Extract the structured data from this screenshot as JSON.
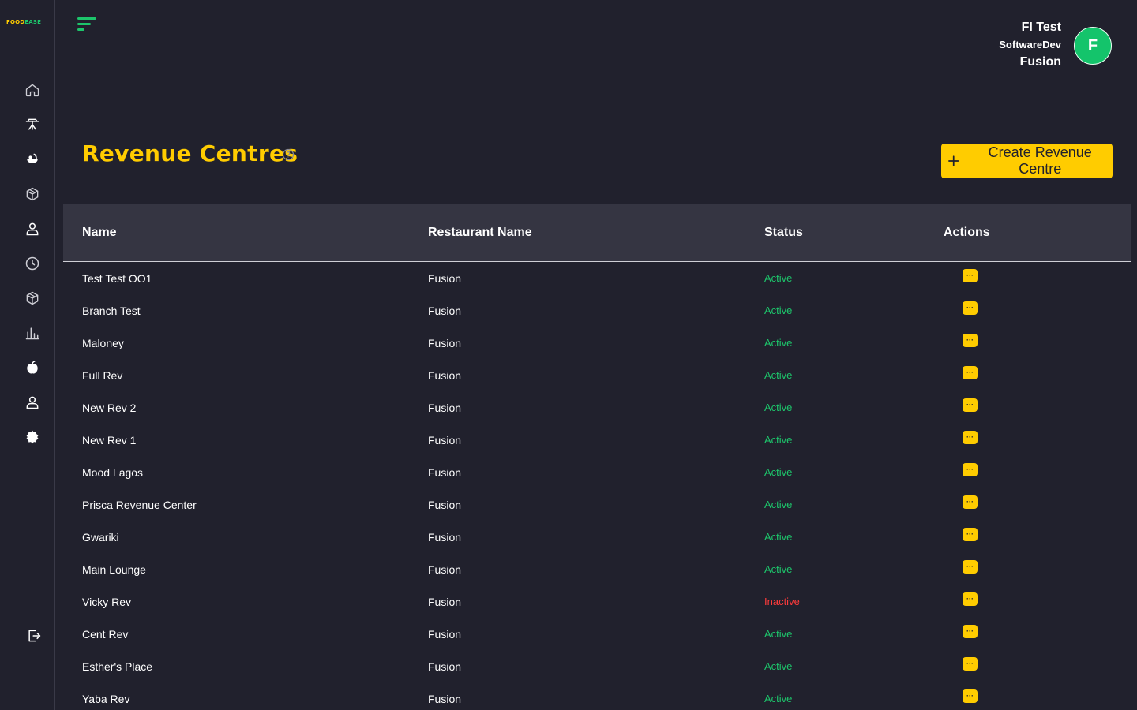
{
  "app": {
    "logo": {
      "part1": "FOOD",
      "part2": "EASE"
    },
    "colors": {
      "background": "#21212d",
      "accent": "#ffcc00",
      "success": "#1dc56b",
      "danger": "#ff3b3b",
      "table_header": "#353542"
    }
  },
  "sidebar": {
    "items": [
      {
        "icon": "home-icon"
      },
      {
        "icon": "table-icon"
      },
      {
        "icon": "food-icon"
      },
      {
        "icon": "box-icon"
      },
      {
        "icon": "user-icon"
      },
      {
        "icon": "clock-icon"
      },
      {
        "icon": "inventory-icon"
      },
      {
        "icon": "chart-icon"
      },
      {
        "icon": "fruit-icon"
      },
      {
        "icon": "staff-icon"
      },
      {
        "icon": "settings-icon"
      }
    ],
    "logout_icon": "logout-icon"
  },
  "header": {
    "user": {
      "name": "FI Test",
      "role": "SoftwareDev",
      "organization": "Fusion",
      "avatar_initial": "F"
    }
  },
  "page": {
    "title": "Revenue Centres",
    "create_button_label": "Create Revenue Centre"
  },
  "table": {
    "columns": {
      "name": "Name",
      "restaurant": "Restaurant Name",
      "status": "Status",
      "actions": "Actions"
    },
    "action_label": "···",
    "rows": [
      {
        "name": "Test Test OO1",
        "restaurant": "Fusion",
        "status": "Active"
      },
      {
        "name": "Branch Test",
        "restaurant": "Fusion",
        "status": "Active"
      },
      {
        "name": "Maloney",
        "restaurant": "Fusion",
        "status": "Active"
      },
      {
        "name": "Full Rev",
        "restaurant": "Fusion",
        "status": "Active"
      },
      {
        "name": "New Rev 2",
        "restaurant": "Fusion",
        "status": "Active"
      },
      {
        "name": "New Rev 1",
        "restaurant": "Fusion",
        "status": "Active"
      },
      {
        "name": "Mood Lagos",
        "restaurant": "Fusion",
        "status": "Active"
      },
      {
        "name": "Prisca Revenue Center",
        "restaurant": "Fusion",
        "status": "Active"
      },
      {
        "name": "Gwariki",
        "restaurant": "Fusion",
        "status": "Active"
      },
      {
        "name": "Main Lounge",
        "restaurant": "Fusion",
        "status": "Active"
      },
      {
        "name": "Vicky Rev",
        "restaurant": "Fusion",
        "status": "Inactive"
      },
      {
        "name": "Cent Rev",
        "restaurant": "Fusion",
        "status": "Active"
      },
      {
        "name": "Esther's Place",
        "restaurant": "Fusion",
        "status": "Active"
      },
      {
        "name": "Yaba Rev",
        "restaurant": "Fusion",
        "status": "Active"
      }
    ]
  }
}
